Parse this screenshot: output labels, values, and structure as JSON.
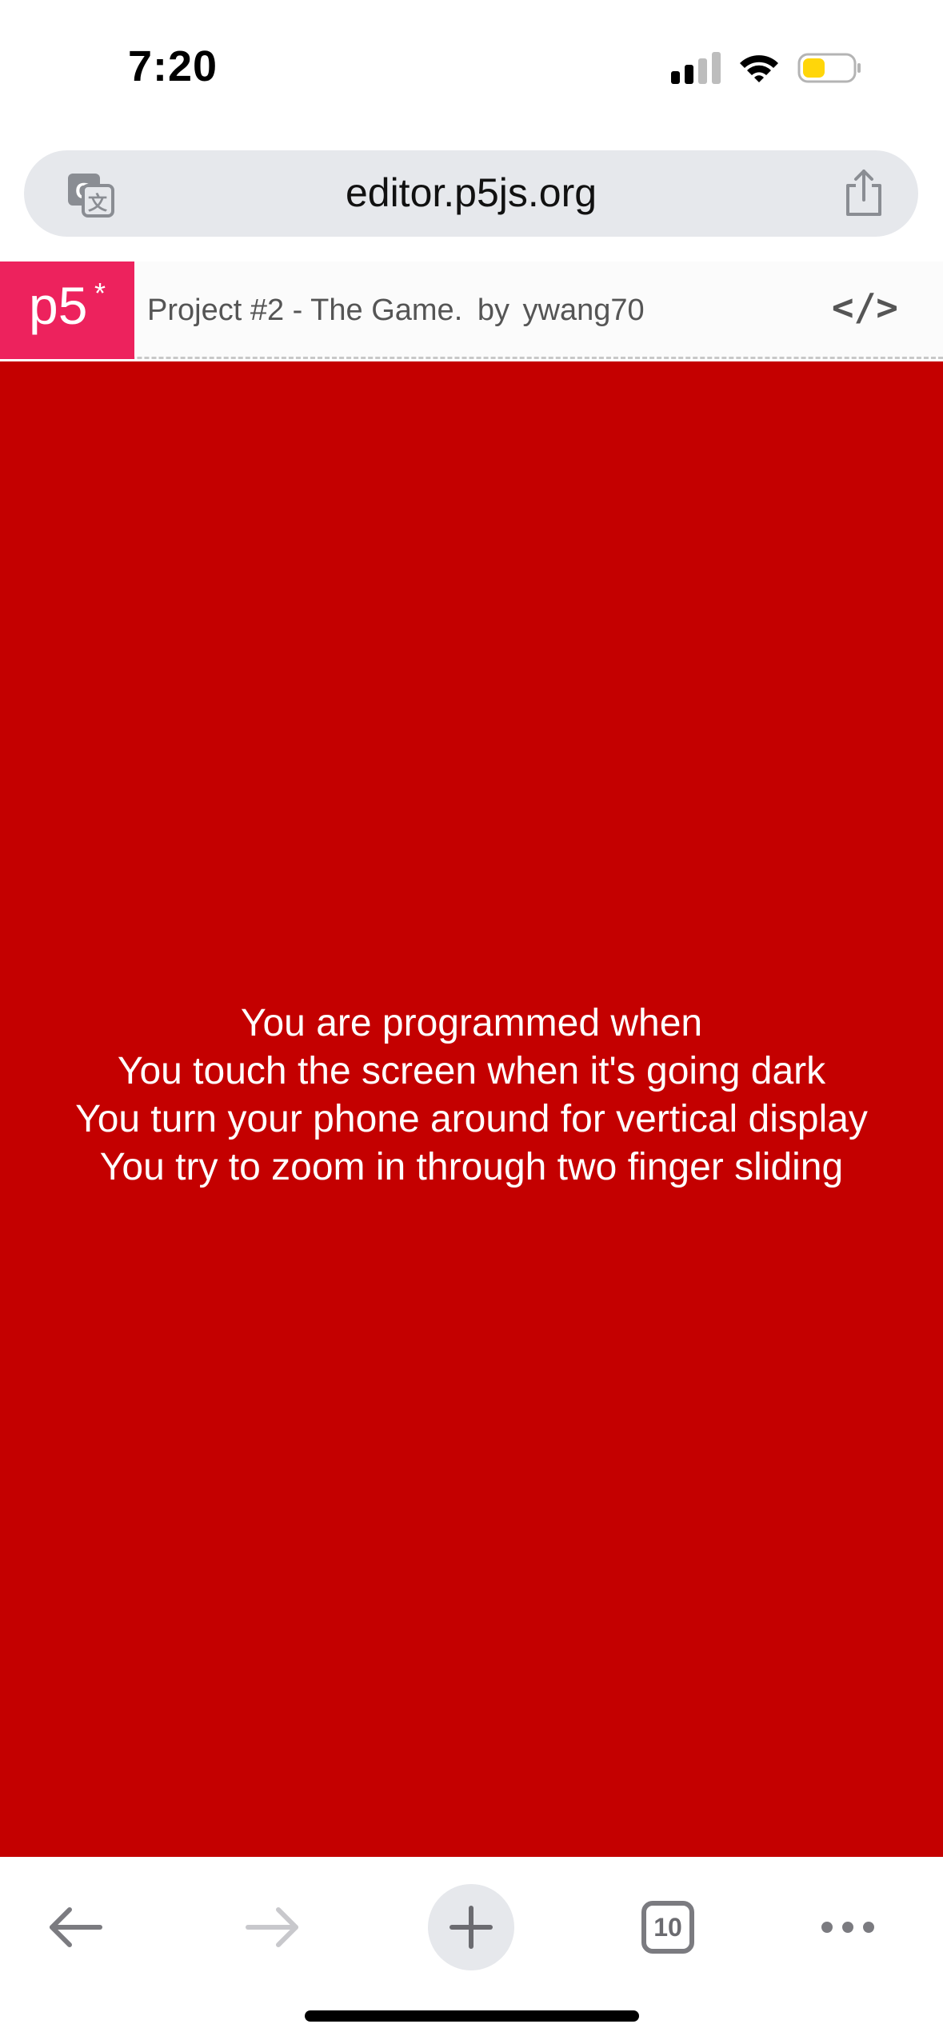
{
  "status_bar": {
    "time": "7:20",
    "signal_icon": "cellular-signal-icon",
    "wifi_icon": "wifi-icon",
    "battery_icon": "battery-icon",
    "battery_color": "#ffd60a"
  },
  "browser": {
    "url": "editor.p5js.org",
    "translate_icon": "translate-icon",
    "share_icon": "share-icon"
  },
  "p5_header": {
    "logo": "p5",
    "logo_star": "*",
    "project_title": "Project #2 - The Game.",
    "by_label": "by",
    "author": "ywang70",
    "code_toggle": "</>",
    "brand_color": "#ed225d"
  },
  "sketch": {
    "background_color": "#c40000",
    "lines": [
      "You are programmed when",
      "You touch the screen when it's going dark",
      "You turn your phone around for vertical display",
      "You try to zoom in through two finger sliding"
    ]
  },
  "toolbar": {
    "back_icon": "arrow-left-icon",
    "forward_icon": "arrow-right-icon",
    "new_tab_icon": "plus-icon",
    "tab_count": "10",
    "more_icon": "more-horizontal-icon"
  }
}
